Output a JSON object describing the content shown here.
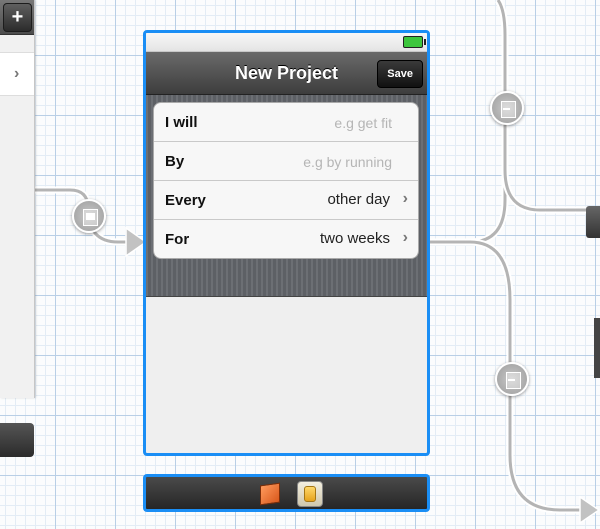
{
  "left_scene": {
    "add_label": "+",
    "chevron": "›"
  },
  "scene": {
    "nav_title": "New Project",
    "save_label": "Save",
    "rows": [
      {
        "label": "I will",
        "placeholder": "e.g get fit"
      },
      {
        "label": "By",
        "placeholder": "e.g by running"
      },
      {
        "label": "Every",
        "value": "other day",
        "chevron": "›"
      },
      {
        "label": "For",
        "value": "two weeks",
        "chevron": "›"
      }
    ]
  },
  "icons": {
    "segue": "modal-segue-icon",
    "exit": "push-segue-icon",
    "dock_first": "first-responder-cube-icon",
    "dock_second": "files-owner-icon"
  },
  "colors": {
    "selection": "#1a8ef5",
    "navbar": "#4a4a4a",
    "grid": "#b9cfe6"
  }
}
